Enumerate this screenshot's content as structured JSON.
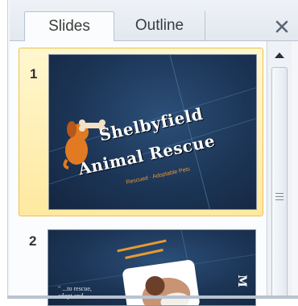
{
  "tabs": {
    "slides_label": "Slides",
    "outline_label": "Outline"
  },
  "icons": {
    "close": "close-icon",
    "scroll_up": "triangle-up-icon",
    "grip": "scroll-grip-icon"
  },
  "colors": {
    "selection_bg": "#ffe9a0",
    "selection_border": "#f0c050",
    "slide_bg": "#1c3556",
    "logo_orange": "#e17a22"
  },
  "slides": [
    {
      "number": "1",
      "title_line1": "Shelbyfield",
      "title_line2": "Animal Rescue",
      "subtitle": "Rescued · Adoptable Pets"
    },
    {
      "number": "2",
      "quote": "\" ...to rescue,",
      "quote_line2": "adopt and"
    }
  ]
}
